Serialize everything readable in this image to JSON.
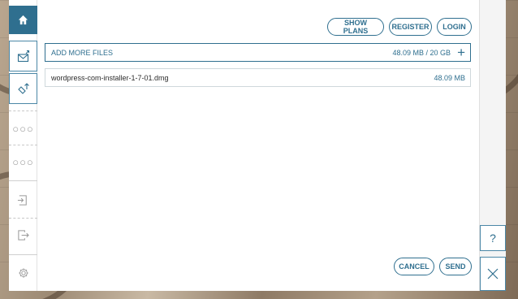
{
  "header": {
    "show_plans": "SHOW PLANS",
    "register": "REGISTER",
    "login": "LOGIN"
  },
  "upload": {
    "add_more_label": "ADD MORE FILES",
    "quota": "48.09 MB / 20 GB",
    "files": [
      {
        "name": "wordpress-com-installer-1-7-01.dmg",
        "size": "48.09 MB"
      }
    ]
  },
  "footer": {
    "cancel": "CANCEL",
    "send": "SEND"
  },
  "right": {
    "help_label": "?"
  },
  "colors": {
    "accent": "#2f6f8f",
    "panel": "#ffffff",
    "muted": "#9a9a9a"
  },
  "icons": [
    "home-icon",
    "mail-upload-icon",
    "transfer-link-icon",
    "more-icon",
    "sign-in-icon",
    "sign-out-icon",
    "settings-icon",
    "help-icon",
    "close-icon",
    "add-icon"
  ]
}
